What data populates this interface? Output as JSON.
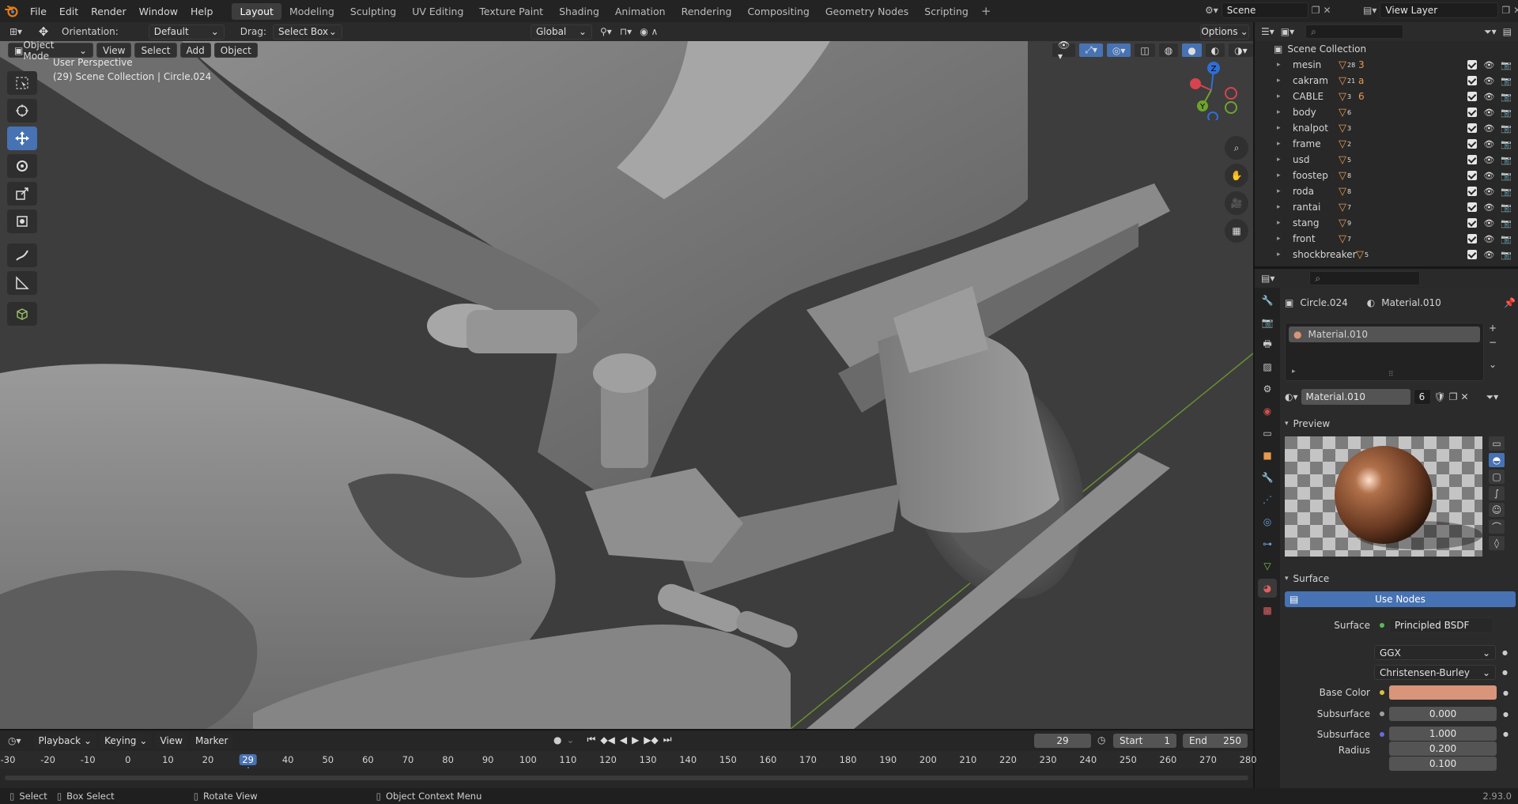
{
  "topbar": {
    "menu": [
      "File",
      "Edit",
      "Render",
      "Window",
      "Help"
    ],
    "workspaces": [
      "Layout",
      "Modeling",
      "Sculpting",
      "UV Editing",
      "Texture Paint",
      "Shading",
      "Animation",
      "Rendering",
      "Compositing",
      "Geometry Nodes",
      "Scripting"
    ],
    "active_workspace": "Layout",
    "scene": "Scene",
    "view_layer": "View Layer"
  },
  "toolheader": {
    "orientation_label": "Orientation:",
    "orientation_value": "Default",
    "drag_label": "Drag:",
    "drag_value": "Select Box",
    "transform_orientation": "Global",
    "options": "Options"
  },
  "viewport_header": {
    "mode": "Object Mode",
    "view": "View",
    "select": "Select",
    "add": "Add",
    "object": "Object"
  },
  "viewport": {
    "perspective": "User Perspective",
    "collection_info": "(29) Scene Collection | Circle.024",
    "gizmo_labels": {
      "z": "Z",
      "y": "Y",
      "x": "X"
    }
  },
  "outliner": {
    "search_placeholder": "",
    "root": "Scene Collection",
    "items": [
      {
        "name": "mesin",
        "badge": "28",
        "extra": "3"
      },
      {
        "name": "cakram",
        "badge": "21",
        "extra": "a"
      },
      {
        "name": "CABLE",
        "badge": "3",
        "extra": "6"
      },
      {
        "name": "body",
        "badge": "6",
        "extra": ""
      },
      {
        "name": "knalpot",
        "badge": "3",
        "extra": ""
      },
      {
        "name": "frame",
        "badge": "2",
        "extra": ""
      },
      {
        "name": "usd",
        "badge": "5",
        "extra": ""
      },
      {
        "name": "foostep",
        "badge": "8",
        "extra": ""
      },
      {
        "name": "roda",
        "badge": "8",
        "extra": ""
      },
      {
        "name": "rantai",
        "badge": "7",
        "extra": ""
      },
      {
        "name": "stang",
        "badge": "9",
        "extra": ""
      },
      {
        "name": "front",
        "badge": "7",
        "extra": ""
      },
      {
        "name": "shockbreaker",
        "badge": "5",
        "extra": ""
      }
    ]
  },
  "properties": {
    "object_name": "Circle.024",
    "material_name": "Material.010",
    "slot_name": "Material.010",
    "material_field": "Material.010",
    "user_count": "6",
    "preview_panel": "Preview",
    "surface_panel": "Surface",
    "use_nodes": "Use Nodes",
    "surface_label": "Surface",
    "surface_value": "Principled BSDF",
    "distribution": "GGX",
    "subsurface_method": "Christensen-Burley",
    "base_color_label": "Base Color",
    "base_color": "#d8957a",
    "subsurface_label": "Subsurface",
    "subsurface_value": "0.000",
    "subsurface_radius_label": "Subsurface Radius",
    "subsurface_radius": [
      "1.000",
      "0.200",
      "0.100"
    ]
  },
  "timeline": {
    "playback": "Playback",
    "keying": "Keying",
    "view": "View",
    "marker": "Marker",
    "current_frame": "29",
    "start_label": "Start",
    "start": "1",
    "end_label": "End",
    "end": "250",
    "ticks": [
      "-30",
      "-20",
      "-10",
      "0",
      "10",
      "20",
      "29",
      "40",
      "50",
      "60",
      "70",
      "80",
      "90",
      "100",
      "110",
      "120",
      "130",
      "140",
      "150",
      "160",
      "170",
      "180",
      "190",
      "200",
      "210",
      "220",
      "230",
      "240",
      "250",
      "260",
      "270",
      "280"
    ]
  },
  "statusbar": {
    "select": "Select",
    "box_select": "Box Select",
    "rotate_view": "Rotate View",
    "context_menu": "Object Context Menu",
    "version": "2.93.0"
  },
  "colors": {
    "accent": "#4772b3",
    "orange": "#e79a4e",
    "base_color": "#d8957a"
  }
}
